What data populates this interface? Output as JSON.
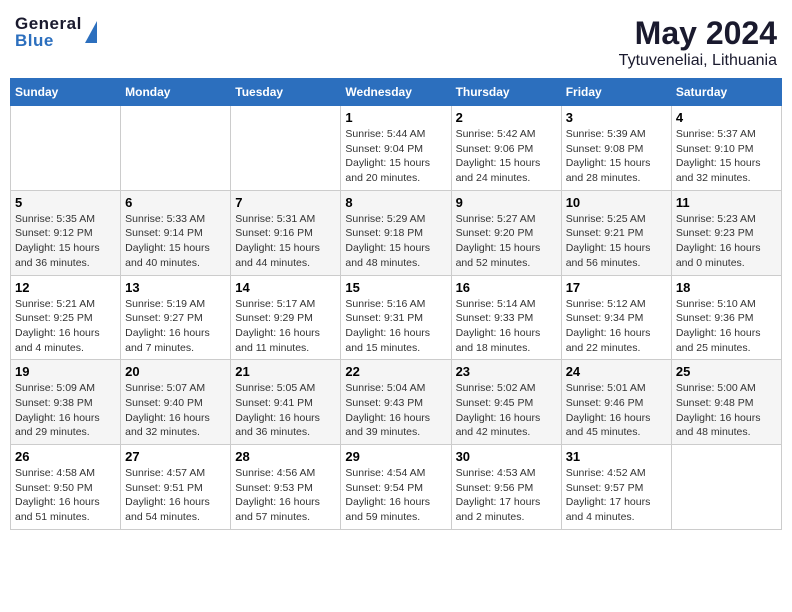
{
  "header": {
    "logo_line1": "General",
    "logo_line2": "Blue",
    "main_title": "May 2024",
    "subtitle": "Tytuveneliai, Lithuania"
  },
  "calendar": {
    "days_of_week": [
      "Sunday",
      "Monday",
      "Tuesday",
      "Wednesday",
      "Thursday",
      "Friday",
      "Saturday"
    ],
    "weeks": [
      [
        {
          "day": "",
          "details": ""
        },
        {
          "day": "",
          "details": ""
        },
        {
          "day": "",
          "details": ""
        },
        {
          "day": "1",
          "details": "Sunrise: 5:44 AM\nSunset: 9:04 PM\nDaylight: 15 hours\nand 20 minutes."
        },
        {
          "day": "2",
          "details": "Sunrise: 5:42 AM\nSunset: 9:06 PM\nDaylight: 15 hours\nand 24 minutes."
        },
        {
          "day": "3",
          "details": "Sunrise: 5:39 AM\nSunset: 9:08 PM\nDaylight: 15 hours\nand 28 minutes."
        },
        {
          "day": "4",
          "details": "Sunrise: 5:37 AM\nSunset: 9:10 PM\nDaylight: 15 hours\nand 32 minutes."
        }
      ],
      [
        {
          "day": "5",
          "details": "Sunrise: 5:35 AM\nSunset: 9:12 PM\nDaylight: 15 hours\nand 36 minutes."
        },
        {
          "day": "6",
          "details": "Sunrise: 5:33 AM\nSunset: 9:14 PM\nDaylight: 15 hours\nand 40 minutes."
        },
        {
          "day": "7",
          "details": "Sunrise: 5:31 AM\nSunset: 9:16 PM\nDaylight: 15 hours\nand 44 minutes."
        },
        {
          "day": "8",
          "details": "Sunrise: 5:29 AM\nSunset: 9:18 PM\nDaylight: 15 hours\nand 48 minutes."
        },
        {
          "day": "9",
          "details": "Sunrise: 5:27 AM\nSunset: 9:20 PM\nDaylight: 15 hours\nand 52 minutes."
        },
        {
          "day": "10",
          "details": "Sunrise: 5:25 AM\nSunset: 9:21 PM\nDaylight: 15 hours\nand 56 minutes."
        },
        {
          "day": "11",
          "details": "Sunrise: 5:23 AM\nSunset: 9:23 PM\nDaylight: 16 hours\nand 0 minutes."
        }
      ],
      [
        {
          "day": "12",
          "details": "Sunrise: 5:21 AM\nSunset: 9:25 PM\nDaylight: 16 hours\nand 4 minutes."
        },
        {
          "day": "13",
          "details": "Sunrise: 5:19 AM\nSunset: 9:27 PM\nDaylight: 16 hours\nand 7 minutes."
        },
        {
          "day": "14",
          "details": "Sunrise: 5:17 AM\nSunset: 9:29 PM\nDaylight: 16 hours\nand 11 minutes."
        },
        {
          "day": "15",
          "details": "Sunrise: 5:16 AM\nSunset: 9:31 PM\nDaylight: 16 hours\nand 15 minutes."
        },
        {
          "day": "16",
          "details": "Sunrise: 5:14 AM\nSunset: 9:33 PM\nDaylight: 16 hours\nand 18 minutes."
        },
        {
          "day": "17",
          "details": "Sunrise: 5:12 AM\nSunset: 9:34 PM\nDaylight: 16 hours\nand 22 minutes."
        },
        {
          "day": "18",
          "details": "Sunrise: 5:10 AM\nSunset: 9:36 PM\nDaylight: 16 hours\nand 25 minutes."
        }
      ],
      [
        {
          "day": "19",
          "details": "Sunrise: 5:09 AM\nSunset: 9:38 PM\nDaylight: 16 hours\nand 29 minutes."
        },
        {
          "day": "20",
          "details": "Sunrise: 5:07 AM\nSunset: 9:40 PM\nDaylight: 16 hours\nand 32 minutes."
        },
        {
          "day": "21",
          "details": "Sunrise: 5:05 AM\nSunset: 9:41 PM\nDaylight: 16 hours\nand 36 minutes."
        },
        {
          "day": "22",
          "details": "Sunrise: 5:04 AM\nSunset: 9:43 PM\nDaylight: 16 hours\nand 39 minutes."
        },
        {
          "day": "23",
          "details": "Sunrise: 5:02 AM\nSunset: 9:45 PM\nDaylight: 16 hours\nand 42 minutes."
        },
        {
          "day": "24",
          "details": "Sunrise: 5:01 AM\nSunset: 9:46 PM\nDaylight: 16 hours\nand 45 minutes."
        },
        {
          "day": "25",
          "details": "Sunrise: 5:00 AM\nSunset: 9:48 PM\nDaylight: 16 hours\nand 48 minutes."
        }
      ],
      [
        {
          "day": "26",
          "details": "Sunrise: 4:58 AM\nSunset: 9:50 PM\nDaylight: 16 hours\nand 51 minutes."
        },
        {
          "day": "27",
          "details": "Sunrise: 4:57 AM\nSunset: 9:51 PM\nDaylight: 16 hours\nand 54 minutes."
        },
        {
          "day": "28",
          "details": "Sunrise: 4:56 AM\nSunset: 9:53 PM\nDaylight: 16 hours\nand 57 minutes."
        },
        {
          "day": "29",
          "details": "Sunrise: 4:54 AM\nSunset: 9:54 PM\nDaylight: 16 hours\nand 59 minutes."
        },
        {
          "day": "30",
          "details": "Sunrise: 4:53 AM\nSunset: 9:56 PM\nDaylight: 17 hours\nand 2 minutes."
        },
        {
          "day": "31",
          "details": "Sunrise: 4:52 AM\nSunset: 9:57 PM\nDaylight: 17 hours\nand 4 minutes."
        },
        {
          "day": "",
          "details": ""
        }
      ]
    ]
  }
}
